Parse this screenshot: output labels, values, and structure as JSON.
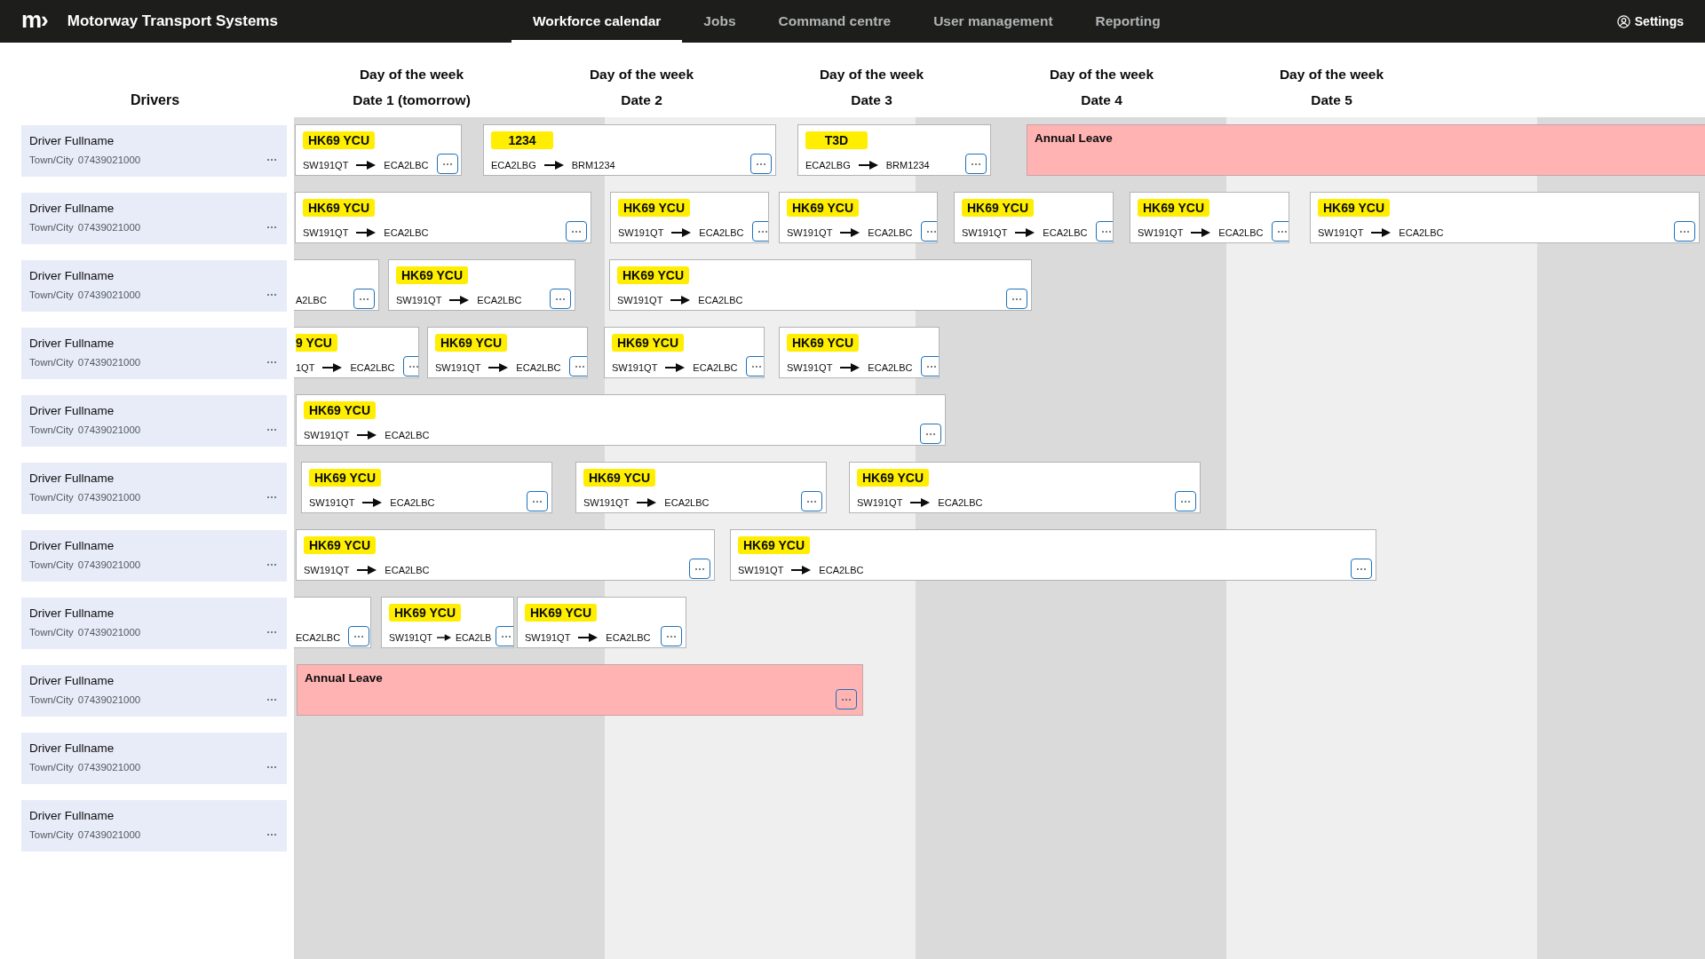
{
  "app": {
    "logo": "m›",
    "title": "Motorway Transport Systems"
  },
  "nav": [
    {
      "label": "Workforce calendar",
      "selected": true
    },
    {
      "label": "Jobs",
      "selected": false
    },
    {
      "label": "Command centre",
      "selected": false
    },
    {
      "label": "User management",
      "selected": false
    },
    {
      "label": "Reporting",
      "selected": false
    }
  ],
  "settings": {
    "label": "Settings"
  },
  "drivers_heading": "Drivers",
  "days": [
    {
      "day": "Day of the week",
      "date": "Date 1 (tomorrow)"
    },
    {
      "day": "Day of the week",
      "date": "Date 2"
    },
    {
      "day": "Day of the week",
      "date": "Date 3"
    },
    {
      "day": "Day of the week",
      "date": "Date 4"
    },
    {
      "day": "Day of the week",
      "date": "Date 5"
    }
  ],
  "drivers": [
    {
      "name": "Driver Fullname",
      "location": "Town/City",
      "phone": "07439021000"
    },
    {
      "name": "Driver Fullname",
      "location": "Town/City",
      "phone": "07439021000"
    },
    {
      "name": "Driver Fullname",
      "location": "Town/City",
      "phone": "07439021000"
    },
    {
      "name": "Driver Fullname",
      "location": "Town/City",
      "phone": "07439021000"
    },
    {
      "name": "Driver Fullname",
      "location": "Town/City",
      "phone": "07439021000"
    },
    {
      "name": "Driver Fullname",
      "location": "Town/City",
      "phone": "07439021000"
    },
    {
      "name": "Driver Fullname",
      "location": "Town/City",
      "phone": "07439021000"
    },
    {
      "name": "Driver Fullname",
      "location": "Town/City",
      "phone": "07439021000"
    },
    {
      "name": "Driver Fullname",
      "location": "Town/City",
      "phone": "07439021000"
    },
    {
      "name": "Driver Fullname",
      "location": "Town/City",
      "phone": "07439021000"
    },
    {
      "name": "Driver Fullname",
      "location": "Town/City",
      "phone": "07439021000"
    }
  ],
  "lanes": [
    [
      {
        "kind": "trip",
        "badge": "HK69 YCU",
        "from": "SW191QT",
        "to": "ECA2LBC"
      },
      {
        "kind": "trip",
        "badge": "1234",
        "from": "ECA2LBG",
        "to": "BRM1234"
      },
      {
        "kind": "trip",
        "badge": "T3D",
        "from": "ECA2LBG",
        "to": "BRM1234"
      },
      {
        "kind": "leave",
        "title": "Annual Leave",
        "menu_button": false
      }
    ],
    [
      {
        "kind": "trip",
        "badge": "HK69 YCU",
        "from": "SW191QT",
        "to": "ECA2LBC"
      },
      {
        "kind": "trip",
        "badge": "HK69 YCU",
        "from": "SW191QT",
        "to": "ECA2LBC"
      },
      {
        "kind": "trip",
        "badge": "HK69 YCU",
        "from": "SW191QT",
        "to": "ECA2LBC"
      },
      {
        "kind": "trip",
        "badge": "HK69 YCU",
        "from": "SW191QT",
        "to": "ECA2LBC"
      },
      {
        "kind": "trip",
        "badge": "HK69 YCU",
        "from": "SW191QT",
        "to": "ECA2LBC"
      },
      {
        "kind": "trip",
        "badge": "HK69 YCU",
        "from": "SW191QT",
        "to": "ECA2LBC"
      }
    ],
    [
      {
        "kind": "partial",
        "to": "A2LBC",
        "arrow": false
      },
      {
        "kind": "trip",
        "badge": "HK69 YCU",
        "from": "SW191QT",
        "to": "ECA2LBC"
      },
      {
        "kind": "trip",
        "badge": "HK69 YCU",
        "from": "SW191QT",
        "to": "ECA2LBC"
      }
    ],
    [
      {
        "kind": "partial",
        "badge": "9 YCU",
        "from": "1QT",
        "to": "ECA2LBC",
        "arrow": true
      },
      {
        "kind": "trip",
        "badge": "HK69 YCU",
        "from": "SW191QT",
        "to": "ECA2LBC"
      },
      {
        "kind": "trip",
        "badge": "HK69 YCU",
        "from": "SW191QT",
        "to": "ECA2LBC"
      },
      {
        "kind": "trip",
        "badge": "HK69 YCU",
        "from": "SW191QT",
        "to": "ECA2LBC"
      }
    ],
    [
      {
        "kind": "trip",
        "badge": "HK69 YCU",
        "from": "SW191QT",
        "to": "ECA2LBC"
      }
    ],
    [
      {
        "kind": "trip",
        "badge": "HK69 YCU",
        "from": "SW191QT",
        "to": "ECA2LBC"
      },
      {
        "kind": "trip",
        "badge": "HK69 YCU",
        "from": "SW191QT",
        "to": "ECA2LBC"
      },
      {
        "kind": "trip",
        "badge": "HK69 YCU",
        "from": "SW191QT",
        "to": "ECA2LBC"
      }
    ],
    [
      {
        "kind": "trip",
        "badge": "HK69 YCU",
        "from": "SW191QT",
        "to": "ECA2LBC"
      },
      {
        "kind": "trip",
        "badge": "HK69 YCU",
        "from": "SW191QT",
        "to": "ECA2LBC"
      }
    ],
    [
      {
        "kind": "partial",
        "to": "ECA2LBC",
        "arrow": false
      },
      {
        "kind": "trip",
        "badge": "HK69 YCU",
        "from": "SW191QT",
        "to": "ECA2LB"
      },
      {
        "kind": "trip",
        "badge": "HK69 YCU",
        "from": "SW191QT",
        "to": "ECA2LBC"
      }
    ],
    [
      {
        "kind": "leave",
        "title": "Annual Leave",
        "menu_button": true
      }
    ]
  ]
}
